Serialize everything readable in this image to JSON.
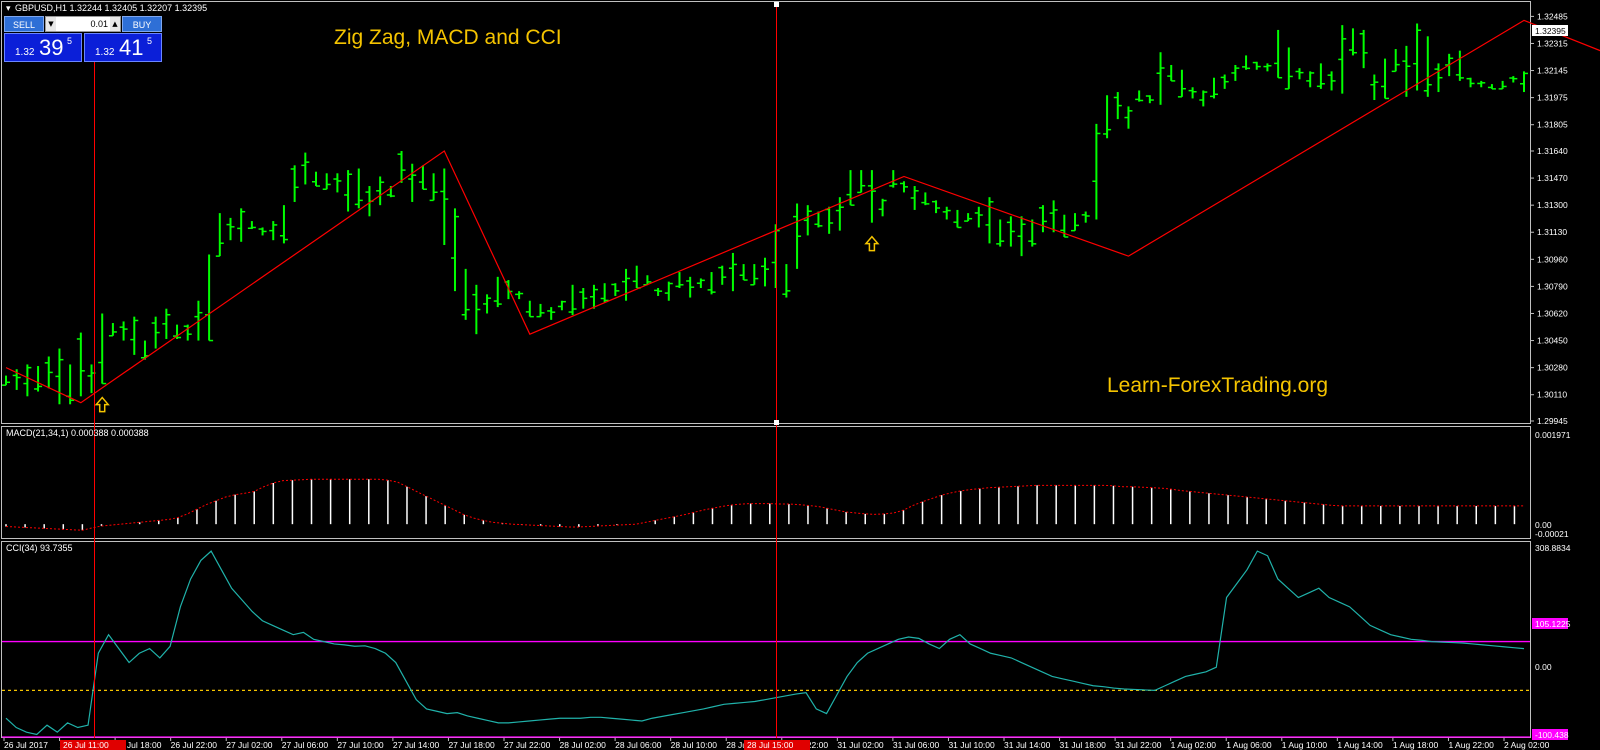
{
  "header": {
    "symbol_info": "GBPUSD,H1  1.32244 1.32405 1.32207 1.32395"
  },
  "trade_panel": {
    "sell_label": "SELL",
    "buy_label": "BUY",
    "lot_value": "0.01",
    "sell_price": {
      "prefix": "1.32",
      "main": "39",
      "sup": "5"
    },
    "buy_price": {
      "prefix": "1.32",
      "main": "41",
      "sup": "5"
    }
  },
  "title": "Zig Zag, MACD and CCI",
  "watermark": "Learn-ForexTrading.org",
  "price_axis": {
    "ticks": [
      "1.32485",
      "1.32315",
      "1.32145",
      "1.31975",
      "1.31805",
      "1.31640",
      "1.31470",
      "1.31300",
      "1.31130",
      "1.30960",
      "1.30790",
      "1.30620",
      "1.30450",
      "1.30280",
      "1.30110",
      "1.29945"
    ],
    "current": "1.32395"
  },
  "macd_panel": {
    "label": "MACD(21,34,1) 0.000388 0.000388",
    "axis_top": "0.001971",
    "axis_zero": "0.00",
    "axis_bottom": "-0.00021"
  },
  "cci_panel": {
    "label": "CCI(34) 93.7355",
    "axis_top": "308.8834",
    "axis_upper": "105.1225",
    "axis_zero": "0.00",
    "axis_lower": "-100.438"
  },
  "time_axis": {
    "labels": [
      "26 Jul 2017",
      "26 Jul 14:00",
      "26 Jul 18:00",
      "26 Jul 22:00",
      "27 Jul 02:00",
      "27 Jul 06:00",
      "27 Jul 10:00",
      "27 Jul 14:00",
      "27 Jul 18:00",
      "27 Jul 22:00",
      "28 Jul 02:00",
      "28 Jul 06:00",
      "28 Jul 10:00",
      "28 Jul 18:00",
      "28 Jul 22:00",
      "31 Jul 02:00",
      "31 Jul 06:00",
      "31 Jul 10:00",
      "31 Jul 14:00",
      "31 Jul 18:00",
      "31 Jul 22:00",
      "1 Aug 02:00",
      "1 Aug 06:00",
      "1 Aug 10:00",
      "1 Aug 14:00",
      "1 Aug 18:00",
      "1 Aug 22:00",
      "2 Aug 02:00"
    ],
    "cursor_label_1": "26 Jul 11:00",
    "cursor_label_2": "28 Jul 15:00"
  },
  "colors": {
    "bars": "#00ff00",
    "zigzag": "#ff0000",
    "macd_hist": "#ffffff",
    "macd_signal": "#ff0000",
    "cci_line": "#20b2aa",
    "cci_levels": "#ff00ff",
    "cci_zero": "#f5c400",
    "arrow": "#f5c400",
    "crosshair": "#ff0000"
  },
  "chart_data": [
    {
      "type": "ohlc",
      "name": "GBPUSD H1",
      "bars_hl": [
        [
          1.3023,
          1.3017
        ],
        [
          1.3027,
          1.3014
        ],
        [
          1.303,
          1.301
        ],
        [
          1.3029,
          1.3013
        ],
        [
          1.3035,
          1.3015
        ],
        [
          1.304,
          1.3005
        ],
        [
          1.303,
          1.3005
        ],
        [
          1.305,
          1.301
        ],
        [
          1.303,
          1.3012
        ],
        [
          1.3062,
          1.3018
        ],
        [
          1.3056,
          1.3048
        ],
        [
          1.3057,
          1.3045
        ],
        [
          1.306,
          1.3036
        ],
        [
          1.3045,
          1.3033
        ],
        [
          1.306,
          1.304
        ],
        [
          1.3065,
          1.3046
        ],
        [
          1.3055,
          1.3046
        ],
        [
          1.3055,
          1.3045
        ],
        [
          1.307,
          1.3045
        ],
        [
          1.3099,
          1.3045
        ],
        [
          1.3125,
          1.3098
        ],
        [
          1.3122,
          1.3108
        ],
        [
          1.3128,
          1.3107
        ],
        [
          1.312,
          1.3115
        ],
        [
          1.3116,
          1.3111
        ],
        [
          1.312,
          1.3108
        ],
        [
          1.313,
          1.3106
        ],
        [
          1.3155,
          1.3132
        ],
        [
          1.3163,
          1.3143
        ],
        [
          1.3151,
          1.3142
        ],
        [
          1.315,
          1.314
        ],
        [
          1.315,
          1.3138
        ],
        [
          1.3152,
          1.3126
        ],
        [
          1.3153,
          1.3128
        ],
        [
          1.3142,
          1.3123
        ],
        [
          1.3148,
          1.313
        ],
        [
          1.3142,
          1.3135
        ],
        [
          1.3164,
          1.3144
        ],
        [
          1.3156,
          1.3132
        ],
        [
          1.3155,
          1.314
        ],
        [
          1.315,
          1.3133
        ],
        [
          1.3153,
          1.3105
        ],
        [
          1.3128,
          1.3076
        ],
        [
          1.309,
          1.3058
        ],
        [
          1.308,
          1.3049
        ],
        [
          1.3074,
          1.3062
        ],
        [
          1.3085,
          1.3066
        ],
        [
          1.3083,
          1.3071
        ],
        [
          1.3076,
          1.3071
        ],
        [
          1.307,
          1.306
        ],
        [
          1.3068,
          1.306
        ],
        [
          1.3066,
          1.3058
        ],
        [
          1.307,
          1.3064
        ],
        [
          1.308,
          1.3061
        ],
        [
          1.3078,
          1.3065
        ],
        [
          1.308,
          1.3065
        ],
        [
          1.3081,
          1.3069
        ],
        [
          1.3081,
          1.3073
        ],
        [
          1.309,
          1.307
        ],
        [
          1.3092,
          1.3078
        ],
        [
          1.3086,
          1.308
        ],
        [
          1.3078,
          1.3073
        ],
        [
          1.3082,
          1.307
        ],
        [
          1.3088,
          1.3078
        ],
        [
          1.3085,
          1.3072
        ],
        [
          1.3084,
          1.3078
        ],
        [
          1.3088,
          1.3074
        ],
        [
          1.3092,
          1.308
        ],
        [
          1.31,
          1.3076
        ],
        [
          1.3093,
          1.3083
        ],
        [
          1.3093,
          1.308
        ],
        [
          1.3097,
          1.3079
        ],
        [
          1.3118,
          1.3078
        ],
        [
          1.3093,
          1.3072
        ],
        [
          1.3131,
          1.309
        ],
        [
          1.313,
          1.3111
        ],
        [
          1.3126,
          1.3116
        ],
        [
          1.3129,
          1.3112
        ],
        [
          1.3135,
          1.3114
        ],
        [
          1.3152,
          1.313
        ],
        [
          1.3152,
          1.3138
        ],
        [
          1.3152,
          1.3119
        ],
        [
          1.3134,
          1.3123
        ],
        [
          1.3152,
          1.3141
        ],
        [
          1.3145,
          1.3138
        ],
        [
          1.3142,
          1.3127
        ],
        [
          1.3138,
          1.313
        ],
        [
          1.3133,
          1.3125
        ],
        [
          1.3129,
          1.3121
        ],
        [
          1.3127,
          1.3116
        ],
        [
          1.3125,
          1.312
        ],
        [
          1.3129,
          1.3116
        ],
        [
          1.3135,
          1.3106
        ],
        [
          1.3121,
          1.3104
        ],
        [
          1.3123,
          1.3104
        ],
        [
          1.3123,
          1.3098
        ],
        [
          1.3121,
          1.3104
        ],
        [
          1.313,
          1.3113
        ],
        [
          1.3133,
          1.3113
        ],
        [
          1.3124,
          1.311
        ],
        [
          1.3125,
          1.3114
        ],
        [
          1.3126,
          1.3119
        ],
        [
          1.3181,
          1.3121
        ],
        [
          1.3199,
          1.3172
        ],
        [
          1.3201,
          1.3184
        ],
        [
          1.3192,
          1.3178
        ],
        [
          1.3202,
          1.3195
        ],
        [
          1.3199,
          1.3194
        ],
        [
          1.3226,
          1.3193
        ],
        [
          1.3218,
          1.3208
        ],
        [
          1.3215,
          1.3198
        ],
        [
          1.3204,
          1.3197
        ],
        [
          1.3202,
          1.3192
        ],
        [
          1.321,
          1.3197
        ],
        [
          1.3212,
          1.3203
        ],
        [
          1.3218,
          1.3208
        ],
        [
          1.3224,
          1.3215
        ],
        [
          1.322,
          1.3215
        ],
        [
          1.3219,
          1.3214
        ],
        [
          1.324,
          1.321
        ],
        [
          1.3229,
          1.3203
        ],
        [
          1.3216,
          1.3209
        ],
        [
          1.3214,
          1.3204
        ],
        [
          1.3219,
          1.3203
        ],
        [
          1.3214,
          1.3202
        ],
        [
          1.3243,
          1.32
        ],
        [
          1.3241,
          1.3224
        ],
        [
          1.324,
          1.3216
        ],
        [
          1.3212,
          1.3196
        ],
        [
          1.3222,
          1.3197
        ],
        [
          1.3228,
          1.3214
        ],
        [
          1.323,
          1.3198
        ],
        [
          1.3244,
          1.3202
        ],
        [
          1.3236,
          1.3198
        ],
        [
          1.3219,
          1.3201
        ],
        [
          1.3225,
          1.3211
        ],
        [
          1.3227,
          1.3208
        ],
        [
          1.321,
          1.3204
        ],
        [
          1.3208,
          1.3204
        ],
        [
          1.3206,
          1.3203
        ],
        [
          1.3208,
          1.3203
        ],
        [
          1.3211,
          1.3207
        ],
        [
          1.3214,
          1.3201
        ]
      ],
      "zigzag": [
        [
          0,
          1.3028
        ],
        [
          7,
          1.3006
        ],
        [
          41,
          1.3164
        ],
        [
          49,
          1.3049
        ],
        [
          84,
          1.3148
        ],
        [
          105,
          1.3098
        ],
        [
          142,
          1.3246
        ],
        [
          160,
          1.3198
        ]
      ],
      "arrows": [
        9,
        81
      ],
      "ylim": [
        1.29945,
        1.325
      ]
    },
    {
      "type": "bar",
      "name": "MACD(21,34,1)",
      "ylim": [
        -0.00021,
        0.00197
      ],
      "values": [
        -5e-05,
        -6e-05,
        -7e-05,
        -8e-05,
        -9e-05,
        -0.0001,
        -0.00011,
        -0.00012,
        -0.00013,
        -8e-05,
        -4e-05,
        -2e-05,
        0.0,
        2e-05,
        4e-05,
        6e-05,
        8e-05,
        0.0001,
        0.00014,
        0.00022,
        0.00032,
        0.00042,
        0.0005,
        0.00058,
        0.00063,
        0.00066,
        0.0007,
        0.0008,
        0.00088,
        0.00093,
        0.00094,
        0.00095,
        0.00096,
        0.00096,
        0.00096,
        0.00096,
        0.00096,
        0.00096,
        0.00096,
        0.00096,
        0.00094,
        0.0009,
        0.0008,
        0.0007,
        0.0006,
        0.0005,
        0.0004,
        0.0003,
        0.0002,
        0.00013,
        8e-05,
        4e-05,
        2e-05,
        0.0,
        -1e-05,
        -2e-05,
        -3e-05,
        -4e-05,
        -5e-05,
        -6e-05,
        -6e-05,
        -5e-05,
        -4e-05,
        -3e-05,
        -2e-05,
        -1e-05,
        0.0,
        4e-05,
        8e-05,
        0.00012,
        0.00016,
        0.0002,
        0.00025,
        0.0003,
        0.00034,
        0.00038,
        0.00041,
        0.00043,
        0.00044,
        0.00044,
        0.00044,
        0.00043,
        0.00043,
        0.00042,
        0.0004,
        0.00038,
        0.00034,
        0.0003,
        0.00026,
        0.00024,
        0.00022,
        0.00021,
        0.00022,
        0.00024,
        0.0003,
        0.0004,
        0.00048,
        0.00055,
        0.00062,
        0.00067,
        0.00071,
        0.00074,
        0.00076,
        0.00078,
        0.00079,
        0.0008,
        0.00081,
        0.00082,
        0.00083,
        0.00083,
        0.00083,
        0.00083,
        0.00083,
        0.00083,
        0.00083,
        0.00083,
        0.00082,
        0.0008,
        0.0008,
        0.00079,
        0.00078,
        0.00077,
        0.00075,
        0.00072,
        0.0007,
        0.00068,
        0.00066,
        0.00064,
        0.00062,
        0.0006,
        0.00058,
        0.00056,
        0.00054,
        0.00052,
        0.0005,
        0.00048,
        0.00046,
        0.00044,
        0.00042,
        0.0004,
        0.00039,
        0.00039,
        0.00039,
        0.00039,
        0.00039,
        0.00039,
        0.00039,
        0.00039,
        0.00039,
        0.00039,
        0.00039,
        0.00039,
        0.00039,
        0.00039,
        0.00039,
        0.00039,
        0.00039,
        0.00039,
        0.00039,
        0.00039
      ]
    },
    {
      "type": "line",
      "name": "CCI(34)",
      "ylim": [
        -100.438,
        308.8834
      ],
      "levels": [
        105.1225,
        0,
        -100.438
      ],
      "values": [
        -60,
        -80,
        -90,
        -95,
        -75,
        -90,
        -70,
        -80,
        -75,
        80,
        120,
        90,
        60,
        80,
        90,
        70,
        95,
        180,
        240,
        280,
        300,
        260,
        220,
        195,
        170,
        150,
        140,
        130,
        120,
        125,
        110,
        105,
        100,
        98,
        95,
        96,
        90,
        80,
        60,
        20,
        -20,
        -40,
        -45,
        -50,
        -48,
        -55,
        -60,
        -65,
        -70,
        -70,
        -68,
        -66,
        -64,
        -62,
        -60,
        -60,
        -60,
        -58,
        -58,
        -60,
        -62,
        -64,
        -66,
        -60,
        -56,
        -52,
        -48,
        -44,
        -40,
        -35,
        -30,
        -28,
        -26,
        -24,
        -20,
        -16,
        -12,
        -8,
        -5,
        -40,
        -50,
        -10,
        30,
        60,
        80,
        90,
        100,
        110,
        115,
        112,
        100,
        90,
        110,
        120,
        100,
        90,
        80,
        75,
        70,
        60,
        50,
        40,
        30,
        25,
        20,
        15,
        10,
        8,
        5,
        3,
        2,
        1,
        0,
        10,
        20,
        30,
        35,
        40,
        50,
        200,
        230,
        260,
        300,
        290,
        240,
        220,
        200,
        210,
        220,
        200,
        190,
        180,
        160,
        140,
        130,
        120,
        115,
        110,
        108,
        105,
        104,
        103,
        102,
        100,
        98,
        96,
        94,
        92,
        90
      ]
    }
  ]
}
